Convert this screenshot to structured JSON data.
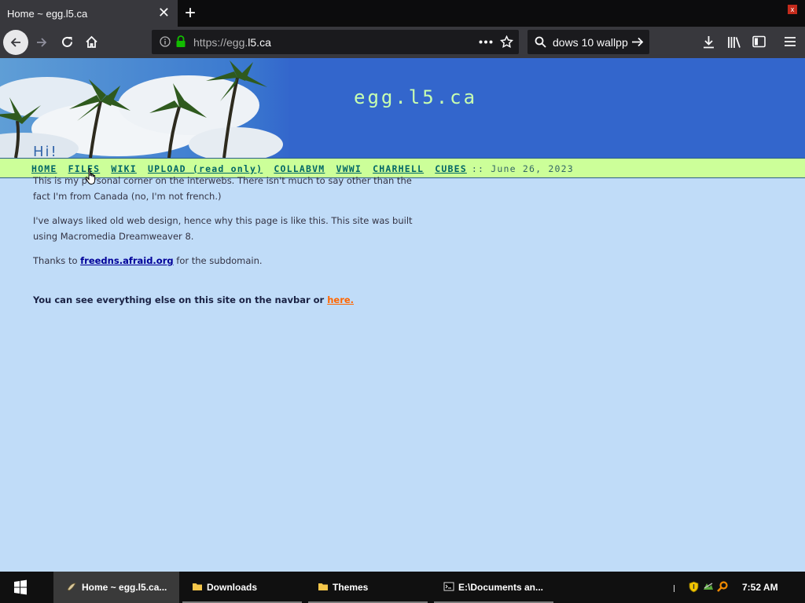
{
  "browser": {
    "tab_title": "Home ~ egg.l5.ca",
    "tab_close": "✕",
    "new_tab": "+",
    "window_close": "x",
    "url_prefix": "https://egg.",
    "url_domain": "l5.ca",
    "search_text": "dows 10 wallpp"
  },
  "site": {
    "title": "egg.l5.ca",
    "nav": {
      "items": [
        "HOME",
        "FILES",
        "WIKI",
        "UPLOAD (read only)",
        "COLLABVM",
        "VWWI",
        "CHARHELL",
        "CUBES"
      ],
      "date": ":: June 26, 2023"
    },
    "greeting": "Hi!",
    "para1": "This is my personal corner on the interwebs. There isn't much to say other than the fact I'm from Canada (no, I'm not french.)",
    "para2": "I've always liked old web design, hence why this page is like this. This site was built using Macromedia Dreamweaver 8.",
    "para3_prefix": "Thanks to ",
    "para3_link": "freedns.afraid.org",
    "para3_suffix": " for the subdomain.",
    "para4_prefix": "You can see everything else on this site on the navbar or ",
    "para4_link": "here."
  },
  "taskbar": {
    "items": [
      {
        "label": "Home ~ egg.l5.ca...",
        "icon": "egg-icon"
      },
      {
        "label": "Downloads",
        "icon": "folder-icon"
      },
      {
        "label": "Themes",
        "icon": "folder-icon"
      },
      {
        "label": "E:\\Documents an...",
        "icon": "cmd-icon"
      }
    ],
    "clock": "7:52 AM"
  },
  "colors": {
    "page_bg": "#c0dcf8",
    "banner_bg": "#3366cc",
    "navbar_bg": "#ccff99",
    "title_color": "#c8ffb0",
    "link_orange": "#ff6600"
  }
}
